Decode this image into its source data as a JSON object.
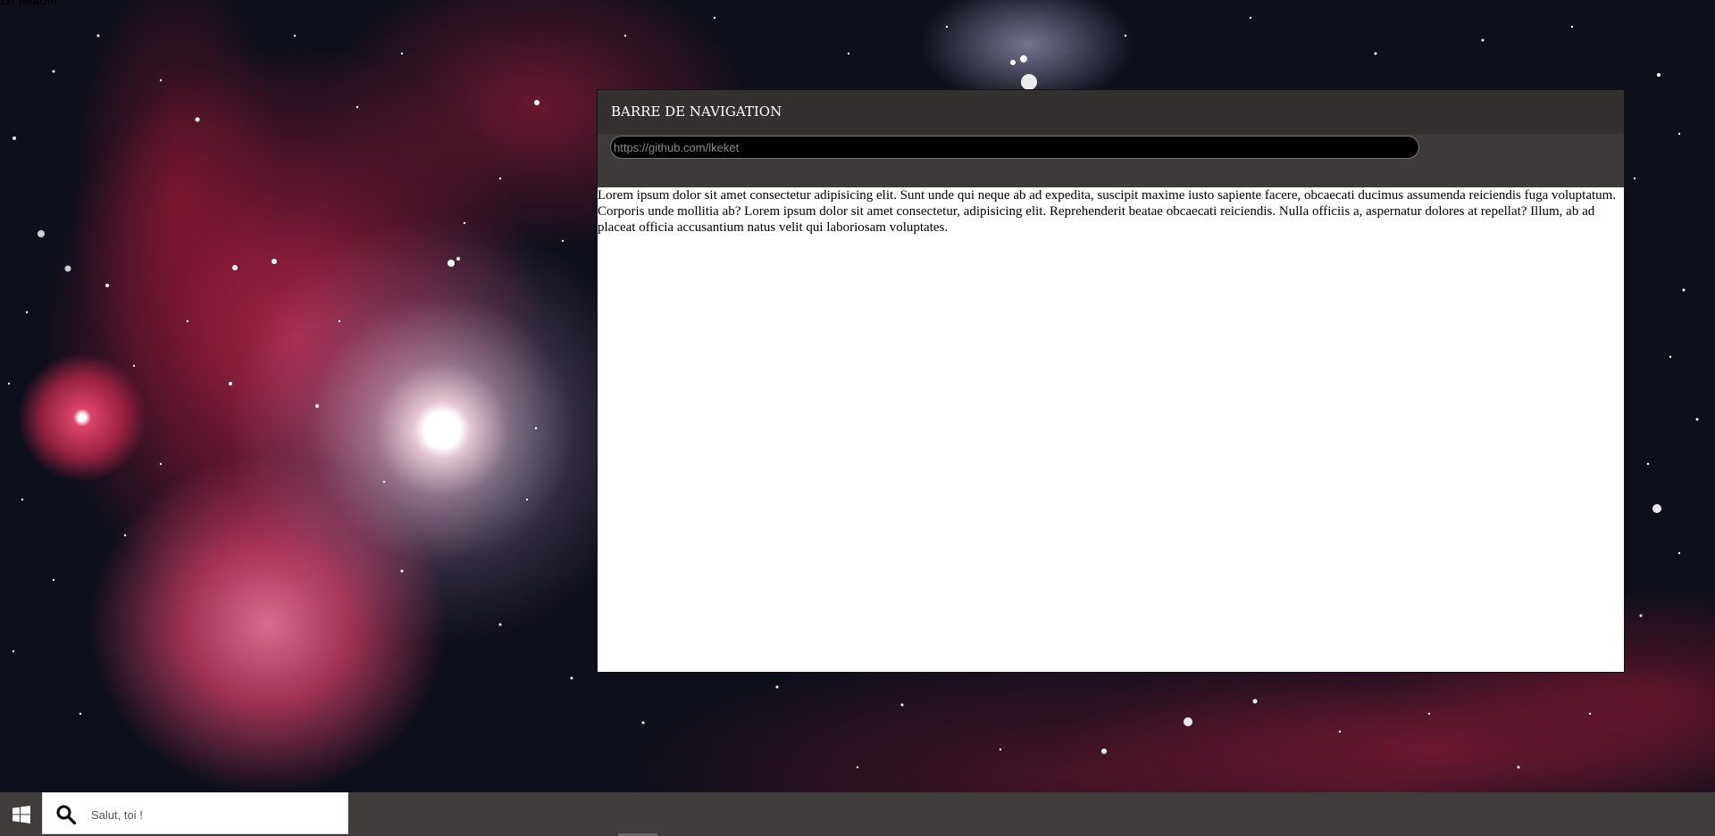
{
  "page": {
    "header_text": "Le header"
  },
  "browser": {
    "title": "BARRE DE NAVIGATION",
    "url_placeholder": "https://github.com/lkeket",
    "content_text": "Lorem ipsum dolor sit amet consectetur adipisicing elit. Sunt unde qui neque ab ad expedita, suscipit maxime iusto sapiente facere, obcaecati ducimus assumenda reiciendis fuga voluptatum. Corporis unde mollitia ab? Lorem ipsum dolor sit amet consectetur, adipisicing elit. Reprehenderit beatae obcaecati reiciendis. Nulla officiis a, aspernatur dolores at repellat? Illum, ab ad placeat officia accusantium natus velit qui laboriosam voluptates."
  },
  "taskbar": {
    "start_icon": "windows-logo-icon",
    "search_icon": "search-icon",
    "search_placeholder": "Salut, toi !"
  },
  "colors": {
    "titlebar_bg": "#33302f",
    "addressbar_bg": "#3d3a39",
    "taskbar_bg": "#3f3c3b",
    "nebula_red": "#c8284f"
  }
}
